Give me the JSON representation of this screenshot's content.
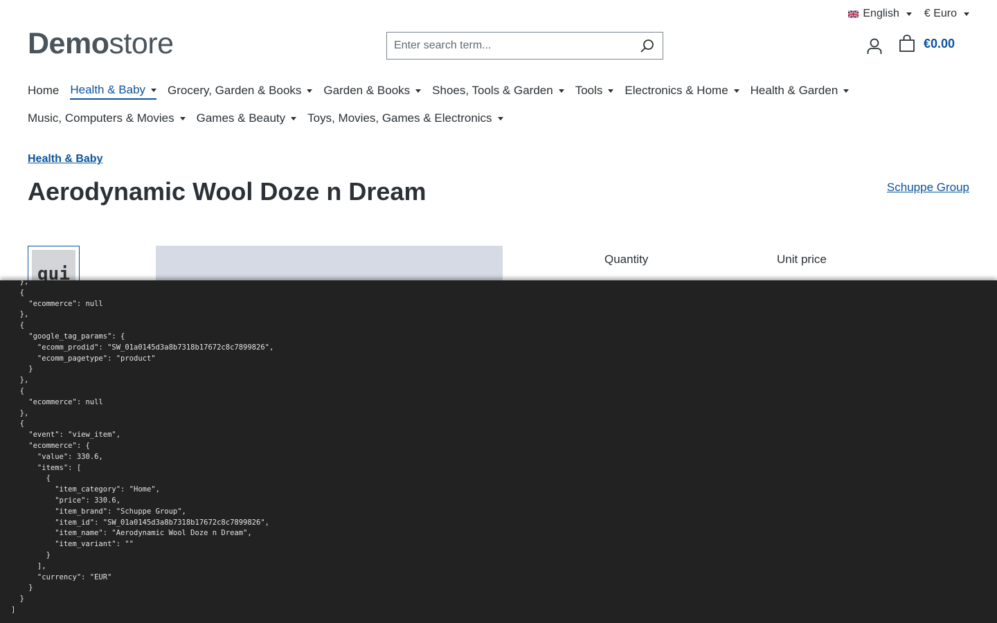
{
  "topbar": {
    "language": "English",
    "currency": "€ Euro"
  },
  "logo": {
    "bold": "Demo",
    "light": "store"
  },
  "search": {
    "placeholder": "Enter search term..."
  },
  "cart": {
    "total": "€0.00"
  },
  "nav": {
    "row1": [
      {
        "label": "Home",
        "dropdown": false,
        "active": false
      },
      {
        "label": "Health & Baby",
        "dropdown": true,
        "active": true
      },
      {
        "label": "Grocery, Garden & Books",
        "dropdown": true,
        "active": false
      },
      {
        "label": "Garden & Books",
        "dropdown": true,
        "active": false
      },
      {
        "label": "Shoes, Tools & Garden",
        "dropdown": true,
        "active": false
      },
      {
        "label": "Tools",
        "dropdown": true,
        "active": false
      },
      {
        "label": "Electronics & Home",
        "dropdown": true,
        "active": false
      },
      {
        "label": "Health & Garden",
        "dropdown": true,
        "active": false
      }
    ],
    "row2": [
      {
        "label": "Music, Computers & Movies",
        "dropdown": true,
        "active": false
      },
      {
        "label": "Games & Beauty",
        "dropdown": true,
        "active": false
      },
      {
        "label": "Toys, Movies, Games & Electronics",
        "dropdown": true,
        "active": false
      }
    ]
  },
  "breadcrumb": "Health & Baby",
  "product": {
    "title": "Aerodynamic Wool Doze n Dream",
    "manufacturer": "Schuppe Group",
    "thumb_text": "qui"
  },
  "table_headers": {
    "quantity": "Quantity",
    "unit_price": "Unit price"
  },
  "console_lines": [
    "  },",
    "  {",
    "    \"ecommerce\": null",
    "  },",
    "  {",
    "    \"google_tag_params\": {",
    "      \"ecomm_prodid\": \"SW_01a0145d3a8b7318b17672c8c7899826\",",
    "      \"ecomm_pagetype\": \"product\"",
    "    }",
    "  },",
    "  {",
    "    \"ecommerce\": null",
    "  },",
    "  {",
    "    \"event\": \"view_item\",",
    "    \"ecommerce\": {",
    "      \"value\": 330.6,",
    "      \"items\": [",
    "        {",
    "          \"item_category\": \"Home\",",
    "          \"price\": 330.6,",
    "          \"item_brand\": \"Schuppe Group\",",
    "          \"item_id\": \"SW_01a0145d3a8b7318b17672c8c7899826\",",
    "          \"item_name\": \"Aerodynamic Wool Doze n Dream\",",
    "          \"item_variant\": \"\"",
    "        }",
    "      ],",
    "      \"currency\": \"EUR\"",
    "    }",
    "  }",
    "]"
  ]
}
